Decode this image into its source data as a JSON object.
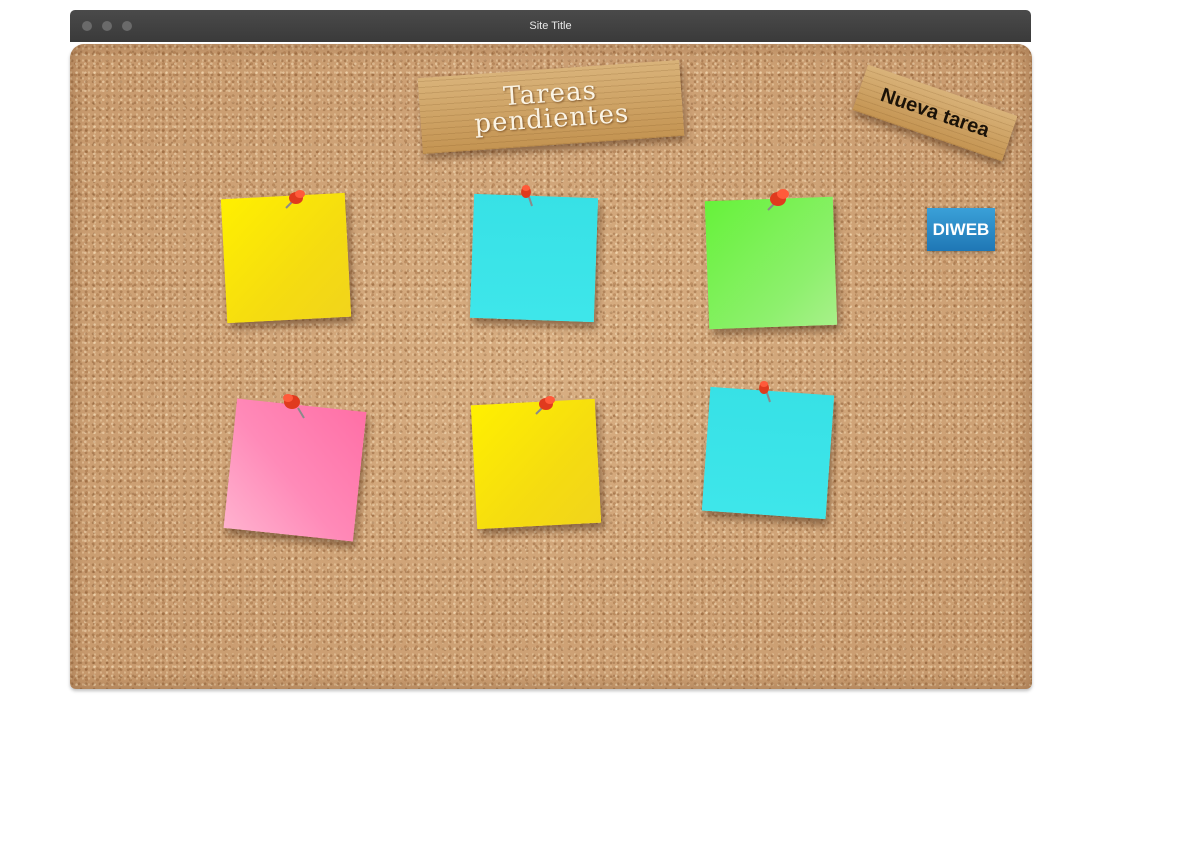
{
  "window": {
    "title": "Site Title"
  },
  "board": {
    "title_line1": "Tareas",
    "title_line2": "pendientes",
    "new_task_label": "Nueva tarea",
    "logo_text": "DIWEB"
  },
  "notes": [
    {
      "color": "yellow",
      "hex": "#f8e400"
    },
    {
      "color": "cyan",
      "hex": "#3ee6ea"
    },
    {
      "color": "green",
      "hex": "#7af04c"
    },
    {
      "color": "pink",
      "hex": "#ff8ab8"
    },
    {
      "color": "yellow",
      "hex": "#f8e400"
    },
    {
      "color": "cyan",
      "hex": "#3ee6ea"
    }
  ],
  "colors": {
    "pin": "#e03a1e",
    "cork": "#cfa377",
    "wood": "#d2a86a"
  }
}
